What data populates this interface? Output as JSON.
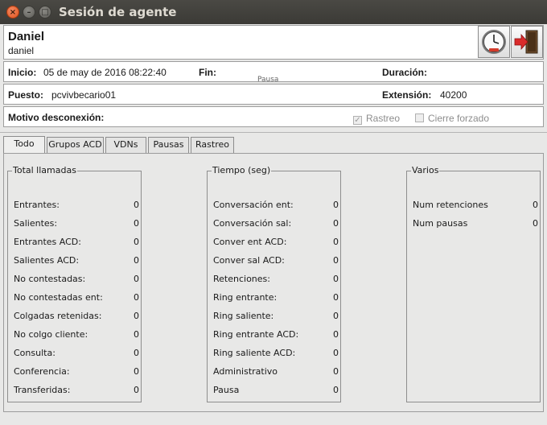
{
  "window": {
    "title": "Sesión de agente"
  },
  "agent": {
    "name": "Daniel",
    "username": "daniel"
  },
  "session": {
    "inicio_label": "Inicio:",
    "inicio_value": "05 de may de 2016 08:22:40",
    "fin_label": "Fin:",
    "fin_value": "",
    "duracion_label": "Duración:",
    "duracion_value": "",
    "puesto_label": "Puesto:",
    "puesto_value": "pcvivbecario01",
    "extension_label": "Extensión:",
    "extension_value": "40200",
    "motivo_label": "Motivo desconexión:",
    "motivo_value": "",
    "ghost_text": "Pausa",
    "rastreo_label": "Rastreo",
    "rastreo_checked": true,
    "cierre_label": "Cierre forzado",
    "cierre_checked": false
  },
  "tabs": [
    {
      "label": "Todo",
      "active": true
    },
    {
      "label": "Grupos ACD",
      "active": false
    },
    {
      "label": "VDNs",
      "active": false
    },
    {
      "label": "Pausas",
      "active": false
    },
    {
      "label": "Rastreo",
      "active": false
    }
  ],
  "groups": {
    "llamadas": {
      "title": "Total llamadas",
      "rows": [
        {
          "label": "Entrantes:",
          "value": "0"
        },
        {
          "label": "Salientes:",
          "value": "0"
        },
        {
          "label": "Entrantes ACD:",
          "value": "0"
        },
        {
          "label": "Salientes ACD:",
          "value": "0"
        },
        {
          "label": "No contestadas:",
          "value": "0"
        },
        {
          "label": "No contestadas ent:",
          "value": "0"
        },
        {
          "label": "Colgadas retenidas:",
          "value": "0"
        },
        {
          "label": "No colgo cliente:",
          "value": "0"
        },
        {
          "label": "Consulta:",
          "value": "0"
        },
        {
          "label": "Conferencia:",
          "value": "0"
        },
        {
          "label": "Transferidas:",
          "value": "0"
        }
      ]
    },
    "tiempo": {
      "title": "Tiempo (seg)",
      "rows": [
        {
          "label": "Conversación ent:",
          "value": "0"
        },
        {
          "label": "Conversación sal:",
          "value": "0"
        },
        {
          "label": "Conver ent ACD:",
          "value": "0"
        },
        {
          "label": "Conver sal ACD:",
          "value": "0"
        },
        {
          "label": "Retenciones:",
          "value": "0"
        },
        {
          "label": "Ring entrante:",
          "value": "0"
        },
        {
          "label": "Ring saliente:",
          "value": "0"
        },
        {
          "label": "Ring entrante ACD:",
          "value": "0"
        },
        {
          "label": "Ring saliente ACD:",
          "value": "0"
        },
        {
          "label": "Administrativo",
          "value": "0"
        },
        {
          "label": "Pausa",
          "value": "0"
        }
      ]
    },
    "varios": {
      "title": "Varios",
      "rows": [
        {
          "label": "Num retenciones",
          "value": "0"
        },
        {
          "label": "Num pausas",
          "value": "0"
        }
      ]
    }
  },
  "icons": {
    "clock": "clock-icon",
    "exit": "exit-door-icon"
  },
  "colors": {
    "titlebar": "#3c3b37",
    "close_button": "#e95420",
    "exit_arrow": "#d92b2b"
  }
}
